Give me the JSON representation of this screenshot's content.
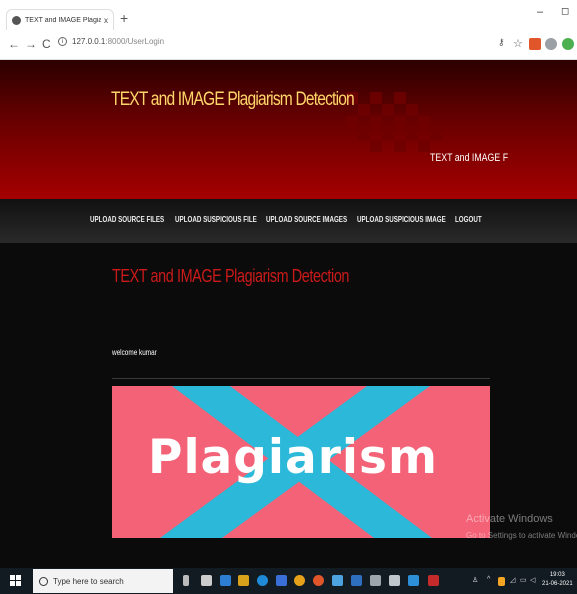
{
  "browser": {
    "tab_title": "TEXT and IMAGE Plagiarism Detec",
    "tab_close": "x",
    "new_tab": "+",
    "url_host": "127.0.0.1",
    "url_path": ":8000/UserLogin",
    "win_min": "–",
    "win_max": "◻"
  },
  "header": {
    "title": "TEXT and IMAGE Plagiarism Detection",
    "tagline": "TEXT and IMAGE F",
    "colors": {
      "title": "#ffd76a",
      "band_top": "#2b0000",
      "band_bottom": "#a50000"
    }
  },
  "nav": {
    "items": [
      {
        "label": "UPLOAD SOURCE FILES"
      },
      {
        "label": "UPLOAD SUSPICIOUS FILE"
      },
      {
        "label": "UPLOAD SOURCE IMAGES"
      },
      {
        "label": "UPLOAD SUSPICIOUS IMAGE"
      },
      {
        "label": "LOGOUT"
      }
    ]
  },
  "main": {
    "heading": "TEXT and IMAGE Plagiarism Detection",
    "welcome": "welcome kumar",
    "banner_text": "Plagiarism",
    "colors": {
      "heading": "#cc1a1a",
      "banner_bg": "#f36276",
      "banner_x": "#2cb8d8"
    }
  },
  "watermark": {
    "line1": "Activate Windows",
    "line2": "Go to Settings to activate Windows."
  },
  "taskbar": {
    "search_placeholder": "Type here to search",
    "time": "19:03",
    "date": "21-06-2021"
  }
}
